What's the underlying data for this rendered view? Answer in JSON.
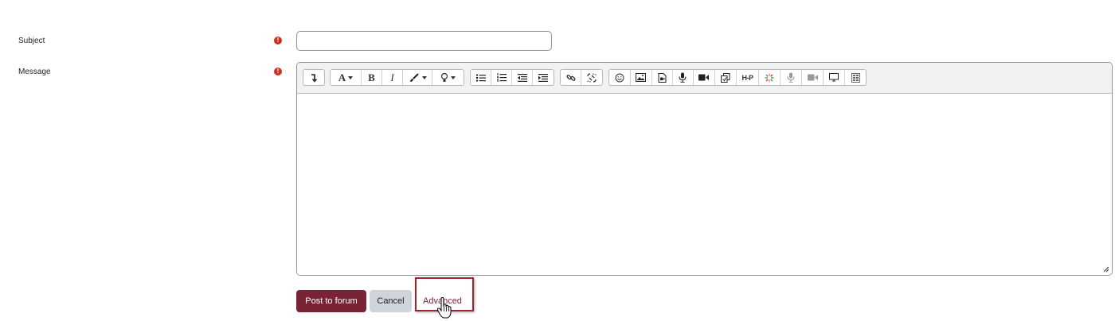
{
  "form": {
    "subject_label": "Subject",
    "message_label": "Message",
    "required_glyph": "!",
    "subject_value": ""
  },
  "toolbar": {
    "font_glyph": "A",
    "bold_glyph": "B",
    "italic_glyph": "I",
    "h5p_label": "H-P",
    "icons": [
      "show-more-icon",
      "font-icon",
      "bold-icon",
      "italic-icon",
      "text-color-icon",
      "highlight-icon",
      "unordered-list-icon",
      "ordered-list-icon",
      "outdent-icon",
      "indent-icon",
      "link-icon",
      "unlink-icon",
      "emoji-icon",
      "image-icon",
      "media-icon",
      "record-audio-icon",
      "record-video-icon",
      "manage-files-icon",
      "h5p-icon",
      "accessibility-checker-icon",
      "mic-icon",
      "video-icon",
      "screen-reader-icon",
      "html-icon"
    ]
  },
  "actions": {
    "post_label": "Post to forum",
    "cancel_label": "Cancel",
    "advanced_label": "Advanced"
  },
  "colors": {
    "primary": "#7a2335",
    "required": "#ca3120",
    "highlight_box": "#a0262b"
  }
}
